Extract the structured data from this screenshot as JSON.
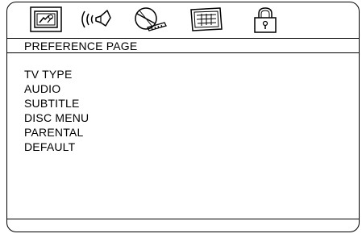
{
  "page": {
    "title": "PREFERENCE PAGE"
  },
  "tabs": [
    {
      "icon": "general-setup-icon"
    },
    {
      "icon": "audio-speaker-icon"
    },
    {
      "icon": "video-disc-icon"
    },
    {
      "icon": "preference-icon"
    },
    {
      "icon": "password-lock-icon"
    }
  ],
  "menu": {
    "items": [
      {
        "label": "TV TYPE"
      },
      {
        "label": "AUDIO"
      },
      {
        "label": "SUBTITLE"
      },
      {
        "label": "DISC MENU"
      },
      {
        "label": "PARENTAL"
      },
      {
        "label": "DEFAULT"
      }
    ]
  },
  "colors": {
    "foreground": "#000000",
    "background": "#ffffff"
  }
}
